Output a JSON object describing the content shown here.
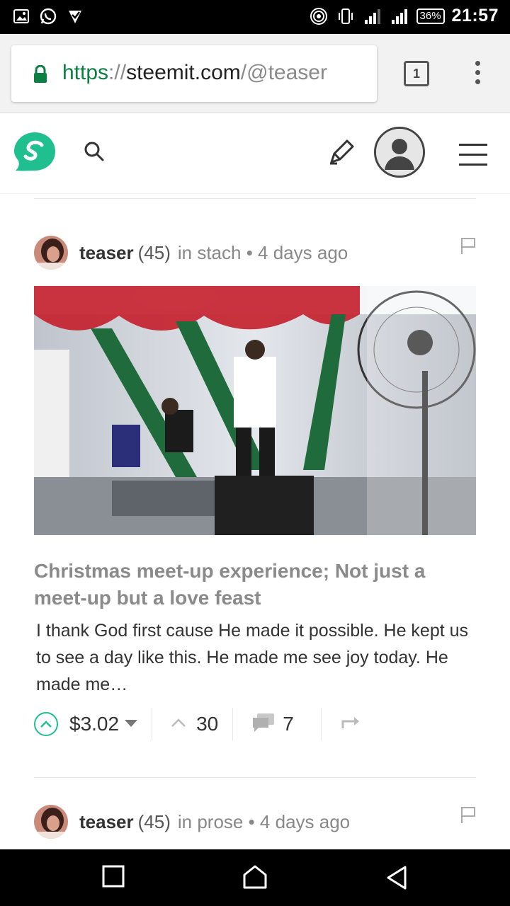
{
  "status_bar": {
    "time": "21:57",
    "battery": "36%",
    "left_icons": [
      "gallery-icon",
      "whatsapp-icon",
      "vpn-icon"
    ],
    "right_icons": [
      "hotspot-icon",
      "vibrate-icon",
      "signal-icon",
      "signal-icon",
      "battery-icon"
    ]
  },
  "browser": {
    "url_scheme": "https",
    "url_sep": "://",
    "url_host": "steemit.com",
    "url_path": "/@teaser",
    "tab_count": "1"
  },
  "site_header": {
    "logo": "steemit-logo-icon",
    "accent_color": "#1fbf8f"
  },
  "posts": [
    {
      "author": "teaser",
      "reputation": "(45)",
      "context": "in stach • 4 days ago",
      "title": "Christmas meet-up experience; Not just a meet-up but a love feast",
      "excerpt": "I thank God first cause He made it possible. He kept us to see a day like this. He made me see joy today. He made me…",
      "payout": "$3.02",
      "votes": "30",
      "comments": "7"
    },
    {
      "author": "teaser",
      "reputation": "(45)",
      "context": "in prose • 4 days ago"
    }
  ]
}
